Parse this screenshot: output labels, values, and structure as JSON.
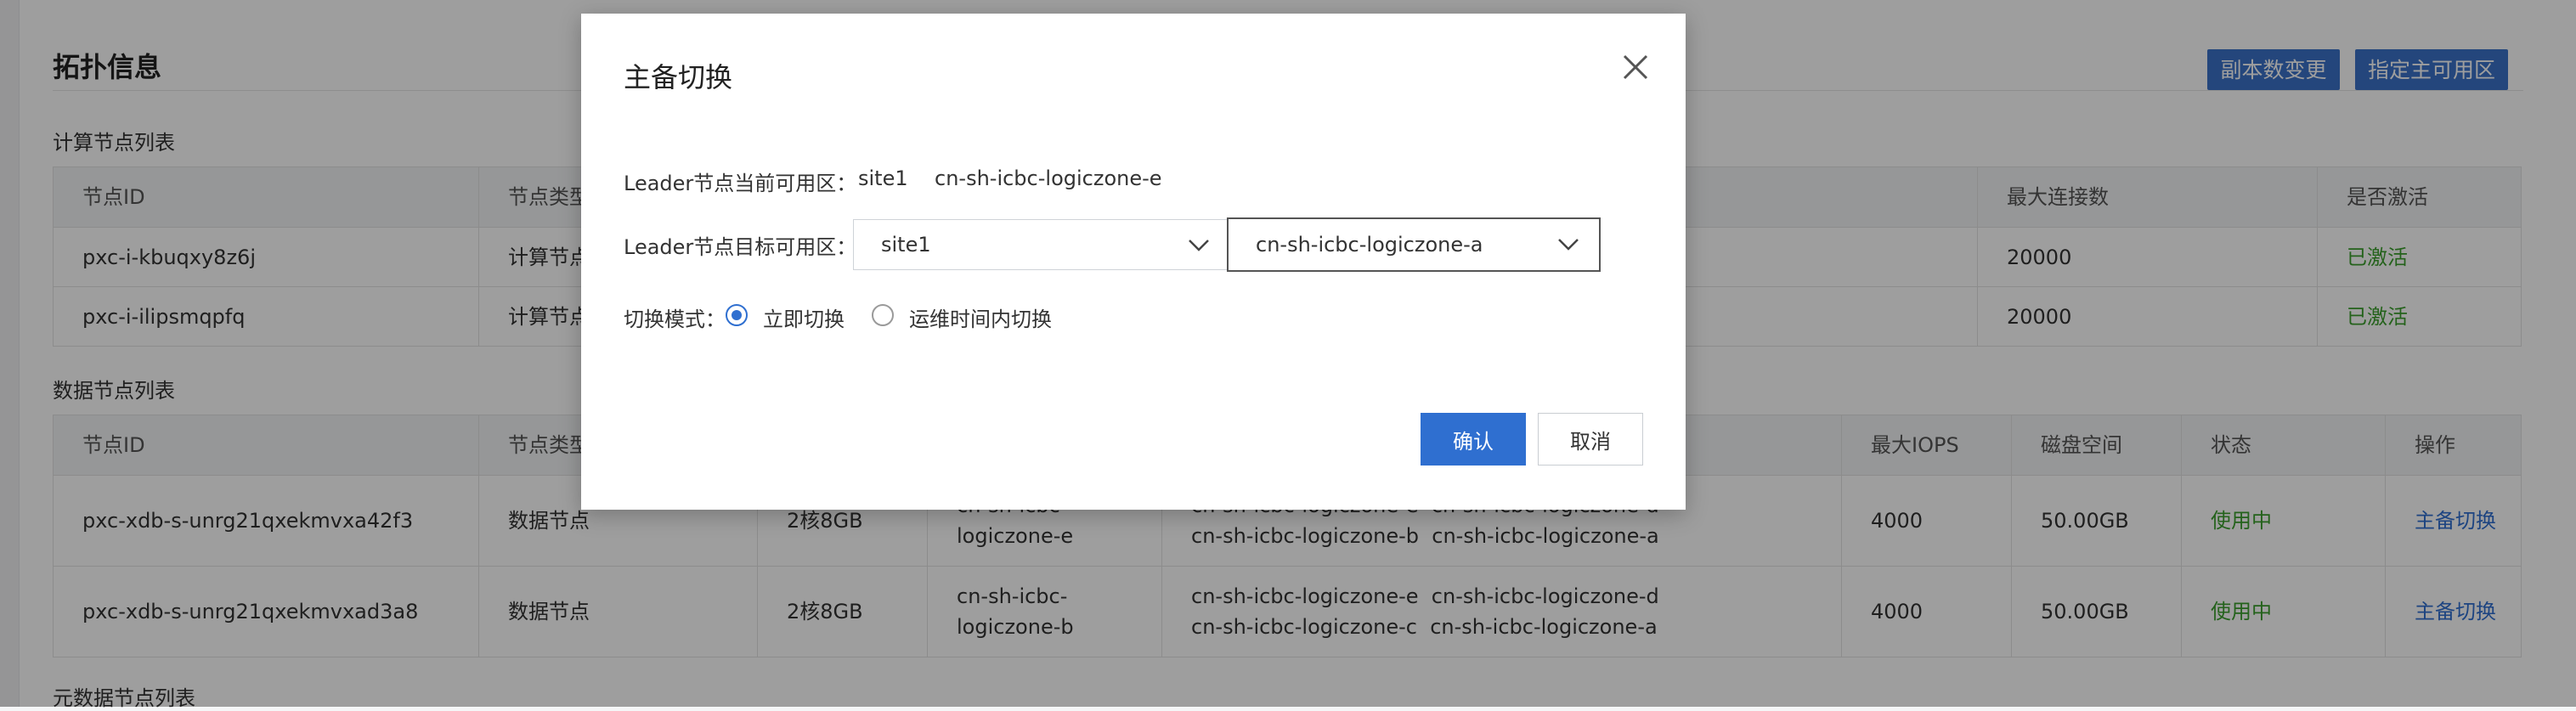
{
  "page": {
    "section_title": "拓扑信息",
    "btn_replica": "副本数变更",
    "btn_primary_zone": "指定主可用区",
    "compute_title": "计算节点列表",
    "data_title": "数据节点列表",
    "meta_title": "元数据节点列表"
  },
  "compute_table": {
    "headers": {
      "node_id": "节点ID",
      "node_type": "节点类型",
      "max_conn": "最大连接数",
      "active": "是否激活"
    },
    "rows": [
      {
        "node_id": "pxc-i-kbuqxy8z6j",
        "node_type": "计算节点",
        "max_conn": "20000",
        "active": "已激活"
      },
      {
        "node_id": "pxc-i-ilipsmqpfq",
        "node_type": "计算节点",
        "max_conn": "20000",
        "active": "已激活"
      }
    ]
  },
  "data_table": {
    "headers": {
      "node_id": "节点ID",
      "node_type": "节点类型",
      "iops": "最大IOPS",
      "disk": "磁盘空间",
      "status": "状态",
      "action": "操作"
    },
    "rows": [
      {
        "node_id": "pxc-xdb-s-unrg21qxekmvxa42f3",
        "node_type": "数据节点",
        "spec": "2核8GB",
        "zone_line1": "cn-sh-icbc-",
        "zone_line2": "logiczone-e",
        "zones_line1": "cn-sh-icbc-logiczone-e  cn-sh-icbc-logiczone-d",
        "zones_line2": "cn-sh-icbc-logiczone-b  cn-sh-icbc-logiczone-a",
        "iops": "4000",
        "disk": "50.00GB",
        "status": "使用中",
        "action": "主备切换"
      },
      {
        "node_id": "pxc-xdb-s-unrg21qxekmvxad3a8",
        "node_type": "数据节点",
        "spec": "2核8GB",
        "zone_line1": "cn-sh-icbc-",
        "zone_line2": "logiczone-b",
        "zones_line1": "cn-sh-icbc-logiczone-e  cn-sh-icbc-logiczone-d",
        "zones_line2": "cn-sh-icbc-logiczone-c  cn-sh-icbc-logiczone-a",
        "iops": "4000",
        "disk": "50.00GB",
        "status": "使用中",
        "action": "主备切换"
      }
    ]
  },
  "modal": {
    "title": "主备切换",
    "current_zone_label": "Leader节点当前可用区：",
    "current_site": "site1",
    "current_zone": "cn-sh-icbc-logiczone-e",
    "target_zone_label": "Leader节点目标可用区：",
    "target_site": "site1",
    "target_zone": "cn-sh-icbc-logiczone-a",
    "mode_label": "切换模式：",
    "mode_immediate": "立即切换",
    "mode_maintenance": "运维时间内切换",
    "confirm": "确认",
    "cancel": "取消"
  },
  "colors": {
    "primary": "#2f6fd0",
    "header_button": "#3a72c8",
    "success": "#3a9f2d"
  },
  "icons": {
    "close": "close-icon",
    "dropdown": "chevron-down-icon"
  }
}
